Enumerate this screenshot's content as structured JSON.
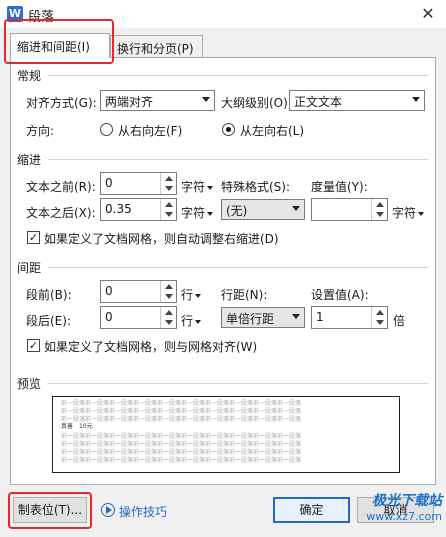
{
  "window": {
    "title": "段落",
    "app_icon_letter": "W"
  },
  "tabs": [
    {
      "label": "缩进和间距(I)"
    },
    {
      "label": "换行和分页(P)"
    }
  ],
  "general": {
    "title": "常规",
    "alignment_label": "对齐方式(G):",
    "alignment_value": "两端对齐",
    "outline_label": "大纲级别(O):",
    "outline_value": "正文文本",
    "direction_label": "方向:",
    "rtl_label": "从右向左(F)",
    "ltr_label": "从左向右(L)",
    "direction_selected": "ltr"
  },
  "indent": {
    "title": "缩进",
    "before_label": "文本之前(R):",
    "before_value": "0",
    "after_label": "文本之后(X):",
    "after_value": "0.35",
    "unit": "字符",
    "special_label": "特殊格式(S):",
    "special_value": "(无)",
    "measure_label": "度量值(Y):",
    "measure_value": "",
    "measure_unit": "字符",
    "auto_adjust_label": "如果定义了文档网格，则自动调整右缩进(D)",
    "auto_adjust_checked": true
  },
  "spacing": {
    "title": "间距",
    "before_label": "段前(B):",
    "before_value": "0",
    "after_label": "段后(E):",
    "after_value": "0",
    "unit": "行",
    "line_label": "行距(N):",
    "line_value": "单倍行距",
    "setting_label": "设置值(A):",
    "setting_value": "1",
    "setting_unit": "倍",
    "snap_grid_label": "如果定义了文档网格，则与网格对齐(W)",
    "snap_grid_checked": true
  },
  "preview": {
    "title": "预览",
    "filler_text": "前一段落前一段落前一段落前一段落前一段落前一段落前一段落前一段落前一段落前一段落",
    "sample_text": "真善　10元"
  },
  "footer": {
    "tabs_button": "制表位(T)...",
    "tips_link": "操作技巧",
    "ok_button": "确定",
    "cancel_button": "取消"
  },
  "watermark": {
    "brand": "极光下载站",
    "url": "www.xz7.com"
  },
  "colors": {
    "highlight": "#e8262c",
    "accent": "#2a66c4"
  }
}
